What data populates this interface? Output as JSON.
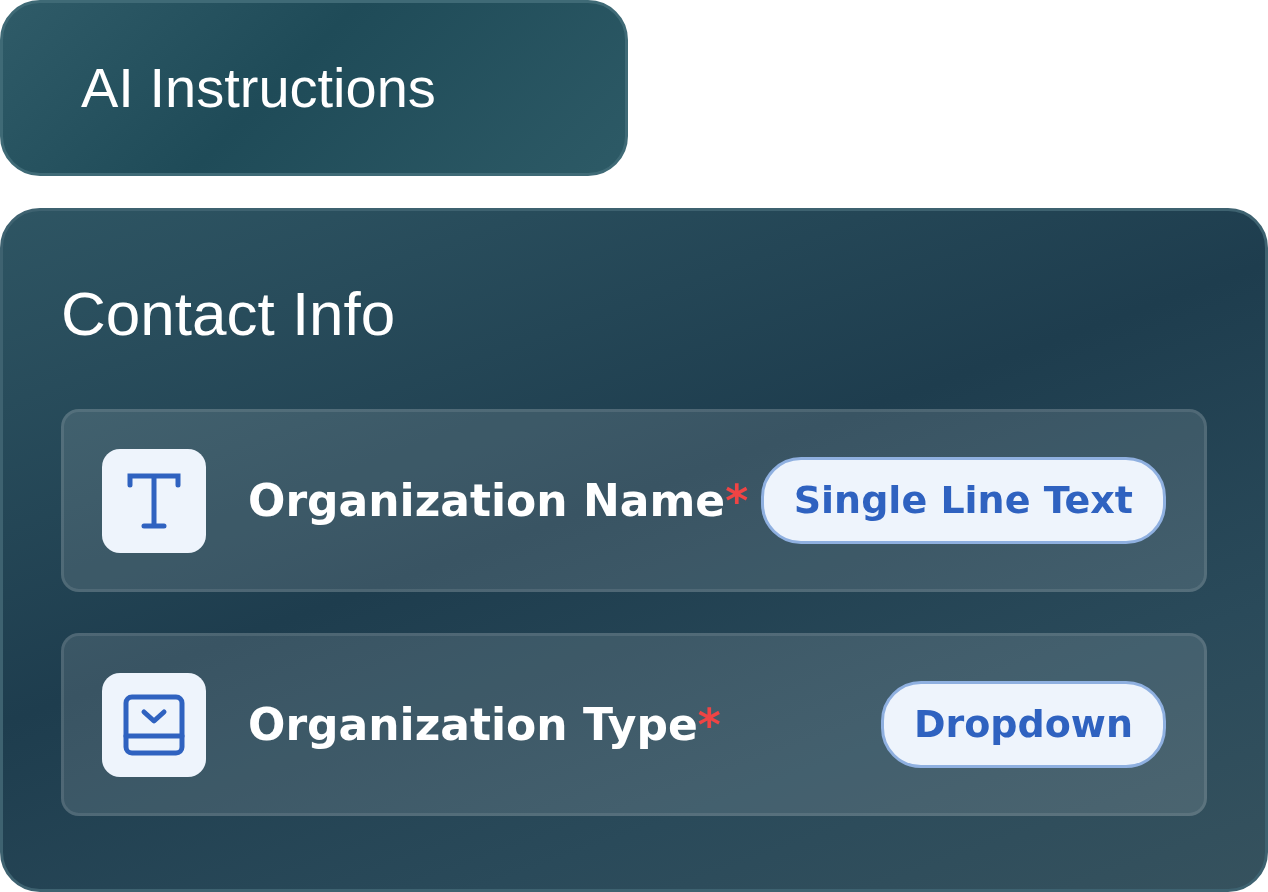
{
  "header": {
    "title": "AI Instructions"
  },
  "section": {
    "title": "Contact Info",
    "fields": [
      {
        "kind": "text",
        "label": "Organization Name",
        "required_mark": "*",
        "type_label": "Single Line Text"
      },
      {
        "kind": "dropdown",
        "label": "Organization Type",
        "required_mark": "*",
        "type_label": "Dropdown"
      }
    ]
  }
}
